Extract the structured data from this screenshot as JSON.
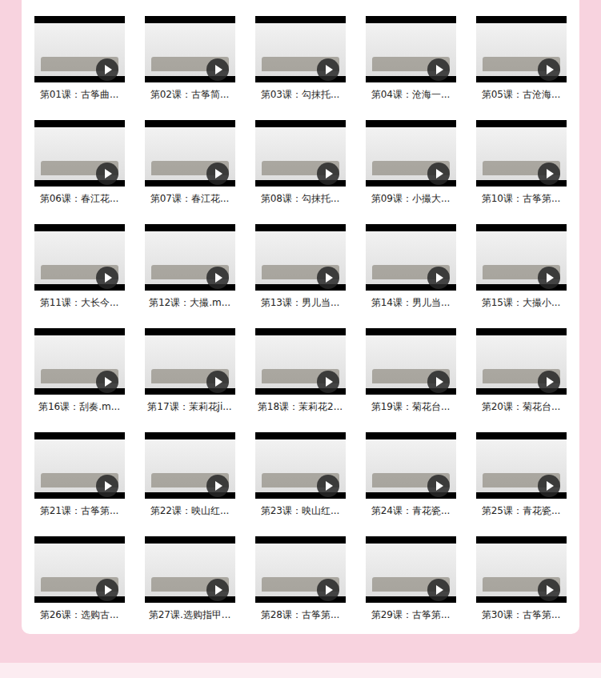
{
  "lessons": [
    {
      "title": "第01课：古筝曲..."
    },
    {
      "title": "第02课：古筝简..."
    },
    {
      "title": "第03课：勾抹托..."
    },
    {
      "title": "第04课：沧海一..."
    },
    {
      "title": "第05课：古沧海..."
    },
    {
      "title": "第06课：春江花..."
    },
    {
      "title": "第07课：春江花..."
    },
    {
      "title": "第08课：勾抹托..."
    },
    {
      "title": "第09课：小撮大..."
    },
    {
      "title": "第10课：古筝第..."
    },
    {
      "title": "第11课：大长今..."
    },
    {
      "title": "第12课：大撮.m..."
    },
    {
      "title": "第13课：男儿当..."
    },
    {
      "title": "第14课：男儿当..."
    },
    {
      "title": "第15课：大撮小..."
    },
    {
      "title": "第16课：刮奏.m..."
    },
    {
      "title": "第17课：茉莉花ji..."
    },
    {
      "title": "第18课：茉莉花2..."
    },
    {
      "title": "第19课：菊花台..."
    },
    {
      "title": "第20课：菊花台..."
    },
    {
      "title": "第21课：古筝第..."
    },
    {
      "title": "第22课：映山红..."
    },
    {
      "title": "第23课：映山红..."
    },
    {
      "title": "第24课：青花瓷..."
    },
    {
      "title": "第25课：青花瓷..."
    },
    {
      "title": "第26课：选购古..."
    },
    {
      "title": "第27课.选购指甲..."
    },
    {
      "title": "第28课：古筝第..."
    },
    {
      "title": "第29课：古筝第..."
    },
    {
      "title": "第30课：古筝第..."
    }
  ]
}
